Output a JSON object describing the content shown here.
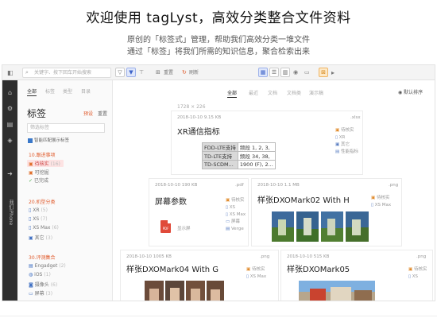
{
  "hero": {
    "title": "欢迎使用 tagLyst，高效分类整合文件资料",
    "line1": "原创的「标签式」管理，帮助我们高效分类一堆文件",
    "line2": "通过「标签」将我们所需的知识信息，聚合检索出来"
  },
  "toolbar": {
    "search_placeholder": "关键字、按下回车开始搜索",
    "reset_label": "重置",
    "refresh_label": "刷新"
  },
  "rail": {
    "vertical_label": "我们iPhone"
  },
  "sidebar": {
    "tabs": [
      "全部",
      "标签",
      "类型",
      "目录"
    ],
    "title": "标签",
    "link_manage": "预设",
    "link_reset": "重置",
    "filter_placeholder": "筛选标签",
    "match_all_label": "智能匹配展示标签",
    "group1": {
      "title": "10.跟进事项",
      "items": [
        {
          "label": "待核实",
          "count": "(16)"
        },
        {
          "label": "可挖掘",
          "count": ""
        },
        {
          "label": "已完成",
          "count": ""
        }
      ]
    },
    "group2": {
      "title": "20.机型分类",
      "items": [
        {
          "label": "XR",
          "count": "(5)"
        },
        {
          "label": "XS",
          "count": "(7)"
        },
        {
          "label": "XS Max",
          "count": "(6)"
        },
        {
          "label": "其它",
          "count": "(3)"
        }
      ]
    },
    "group3": {
      "title": "30.评测集合",
      "items": [
        {
          "label": "Engadget",
          "count": "(2)"
        },
        {
          "label": "iOS",
          "count": "(1)"
        },
        {
          "label": "摄像头",
          "count": "(6)"
        },
        {
          "label": "屏幕",
          "count": "(3)"
        }
      ]
    }
  },
  "main": {
    "tabs": [
      "全部",
      "最近",
      "文档",
      "文档类",
      "演示稿"
    ],
    "sort_label": "默认排序",
    "cut_text": "1728 × 226",
    "cards": {
      "c1": {
        "meta": "2018-10-10  9.15 KB",
        "ext": ".xlsx",
        "title": "XR通信指标",
        "tags": [
          "待核实",
          "XR",
          "其它",
          "性能指标"
        ],
        "table": [
          [
            "FDD-LTE支持",
            "频段 1, 2, 3,"
          ],
          [
            "TD-LTE支持",
            "频段 34, 38,"
          ],
          [
            "TD-SCDM...",
            "1900 (F), 2..."
          ]
        ]
      },
      "c2": {
        "meta": "2018-10-10  190 KB",
        "ext": ".pdf",
        "title": "屏幕参数",
        "file_label": "显示屏",
        "file_badge": "PDF",
        "tags": [
          "待核实",
          "XS",
          "XS Max",
          "屏幕",
          "Verge"
        ]
      },
      "c3": {
        "meta": "2018-10-10  1.1 MB",
        "ext": ".png",
        "title": "样张DXOMark02 With H",
        "tags": [
          "待核实",
          "XS Max"
        ]
      },
      "c4": {
        "meta": "2018-10-10  1005 KB",
        "ext": ".png",
        "title": "样张DXOMark04 With G",
        "tags": [
          "待核实",
          "XS Max"
        ]
      },
      "c5": {
        "meta": "2018-10-10  515 KB",
        "ext": ".png",
        "title": "样张DXOMark05",
        "tags": [
          "待核实",
          "XS"
        ]
      }
    }
  },
  "colors": {
    "accent": "#3f64c8",
    "tag_orange": "#e06e2b",
    "rail": "#2e2e2e"
  }
}
